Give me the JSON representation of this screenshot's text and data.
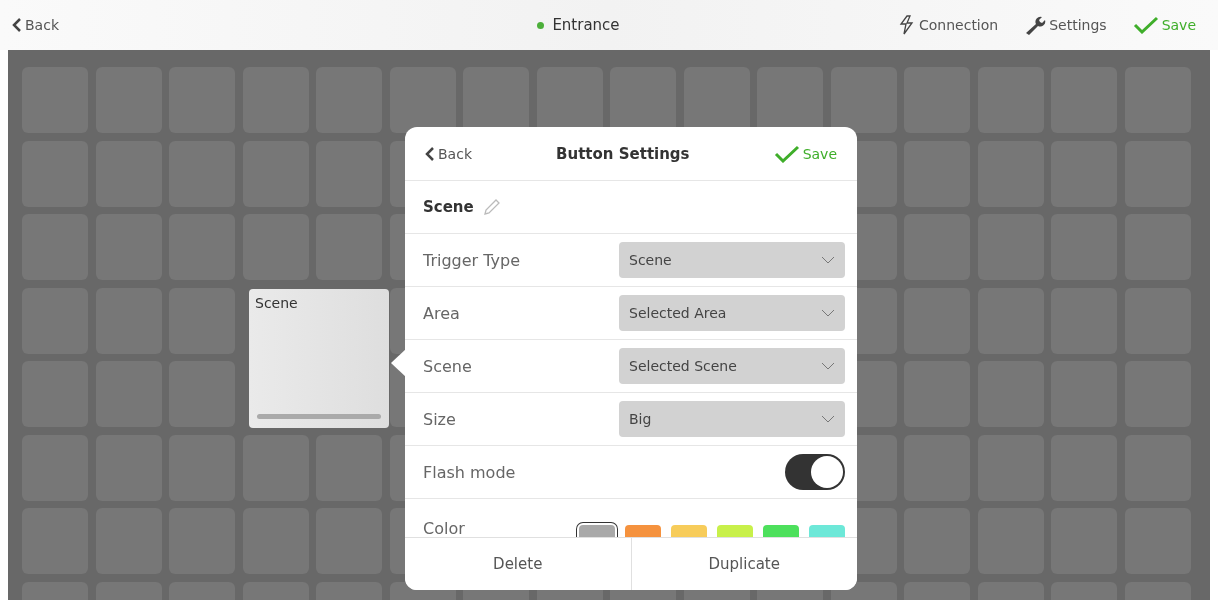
{
  "top_bar": {
    "back": "Back",
    "title": "Entrance",
    "color": "#4caf3a",
    "connection": "Connection",
    "settings": "Settings",
    "save": "Save"
  },
  "preview_tile": {
    "label": "Scene"
  },
  "dialog": {
    "back": "Back",
    "title": "Button Settings",
    "save": "Save",
    "name": "Scene",
    "rows": [
      {
        "kind": "select",
        "label": "Trigger Type",
        "value": "Scene"
      },
      {
        "kind": "select",
        "label": "Area",
        "value": "Selected Area"
      },
      {
        "kind": "select",
        "label": "Scene",
        "value": "Selected Scene"
      },
      {
        "kind": "select",
        "label": "Size",
        "value": "Big"
      },
      {
        "kind": "toggle",
        "label": "Flash mode",
        "on": true
      },
      {
        "kind": "colors",
        "label": "Color",
        "swatches": [
          {
            "color": "#a9a9a9",
            "selected": true
          },
          {
            "color": "#f5923e",
            "selected": false
          },
          {
            "color": "#f7cc5a",
            "selected": false
          },
          {
            "color": "#c8f04a",
            "selected": false
          },
          {
            "color": "#4de05c",
            "selected": false
          },
          {
            "color": "#6de8d8",
            "selected": false
          }
        ]
      }
    ],
    "buttons": [
      "Delete",
      "Duplicate"
    ]
  }
}
